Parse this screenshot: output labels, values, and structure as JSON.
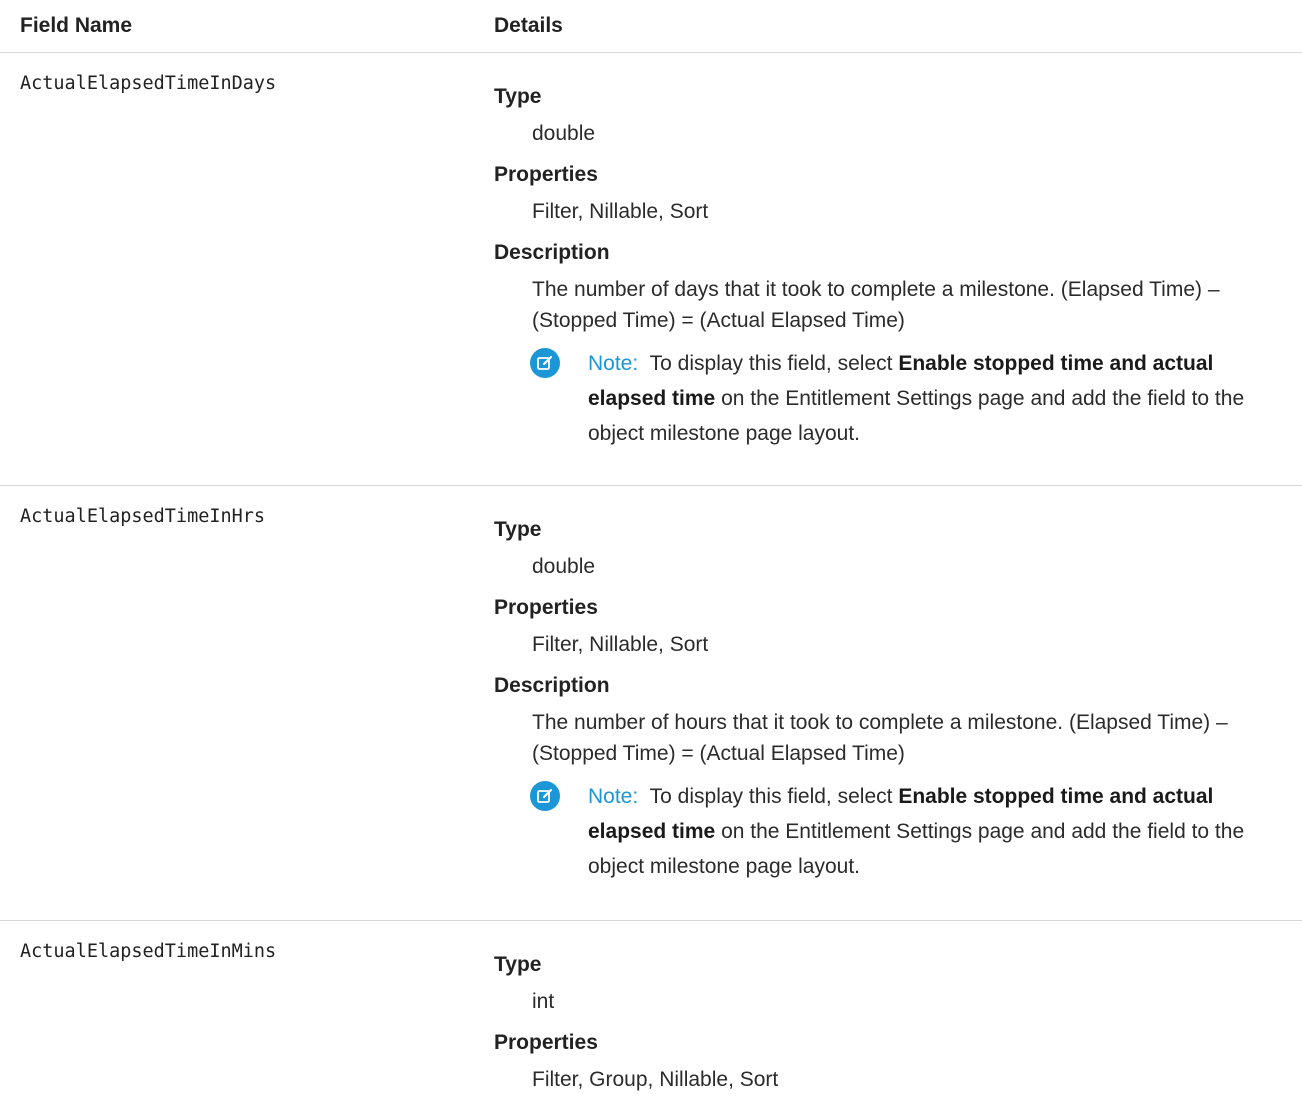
{
  "header": {
    "field_name": "Field Name",
    "details": "Details"
  },
  "rows": [
    {
      "field": "ActualElapsedTimeInDays",
      "type_label": "Type",
      "type_value": "double",
      "properties_label": "Properties",
      "properties_value": "Filter, Nillable, Sort",
      "description_label": "Description",
      "description_value": "The number of days that it took to complete a milestone. (Elapsed Time) – (Stopped Time) = (Actual Elapsed Time)",
      "note": {
        "label": "Note:",
        "text_before": "To display this field, select",
        "bold": "Enable stopped time and actual elapsed time",
        "text_after": "on the Entitlement Settings page and add the field to the object milestone page layout."
      }
    },
    {
      "field": "ActualElapsedTimeInHrs",
      "type_label": "Type",
      "type_value": "double",
      "properties_label": "Properties",
      "properties_value": "Filter, Nillable, Sort",
      "description_label": "Description",
      "description_value": "The number of hours that it took to complete a milestone. (Elapsed Time) – (Stopped Time) = (Actual Elapsed Time)",
      "note": {
        "label": "Note:",
        "text_before": "To display this field, select",
        "bold": "Enable stopped time and actual elapsed time",
        "text_after": "on the Entitlement Settings page and add the field to the object milestone page layout."
      }
    },
    {
      "field": "ActualElapsedTimeInMins",
      "type_label": "Type",
      "type_value": "int",
      "properties_label": "Properties",
      "properties_value": "Filter, Group, Nillable, Sort"
    }
  ],
  "icons": {
    "note": "edit-note-icon"
  },
  "colors": {
    "note_accent": "#1b96d6",
    "divider": "#d8d8d8"
  }
}
